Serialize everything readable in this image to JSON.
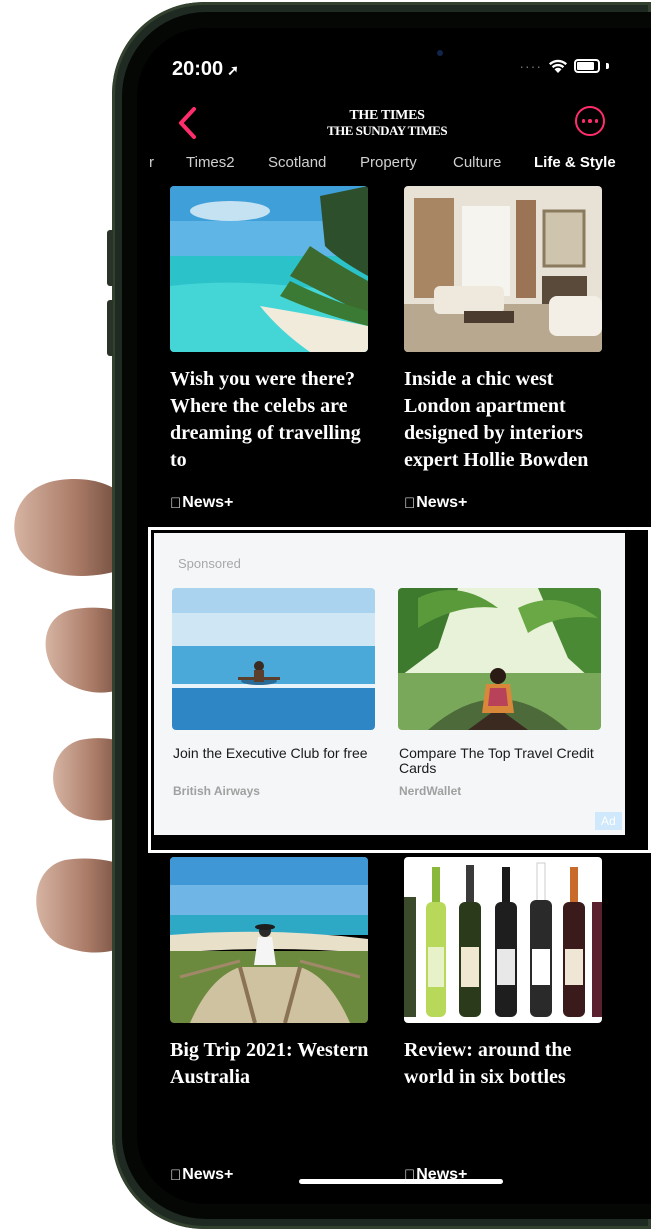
{
  "status_bar": {
    "time": "20:00"
  },
  "header": {
    "brand_line1": "THE TIMES",
    "brand_line2": "THE SUNDAY TIMES"
  },
  "tabs": [
    {
      "label": "r"
    },
    {
      "label": "Times2"
    },
    {
      "label": "Scotland"
    },
    {
      "label": "Property"
    },
    {
      "label": "Culture"
    },
    {
      "label": "Life & Style",
      "active": true
    }
  ],
  "articles": [
    {
      "headline": "Wish you were there? Where the celebs are dreaming of travelling to",
      "badge": "News+"
    },
    {
      "headline": "Inside a chic west London apartment designed by interiors expert Hollie Bowden",
      "badge": "News+"
    },
    {
      "headline": "Big Trip 2021: Western Australia",
      "badge": "News+"
    },
    {
      "headline": "Review: around the world in six bottles",
      "badge": "News+"
    }
  ],
  "sponsored": {
    "label": "Sponsored",
    "badge": "Ad",
    "items": [
      {
        "title": "Join the Executive Club for free",
        "advertiser": "British Airways"
      },
      {
        "title": "Compare The Top Travel Credit Cards",
        "advertiser": "NerdWallet"
      }
    ]
  },
  "colors": {
    "accent": "#ff2d6b",
    "background": "#000000",
    "ad_background": "#f4f6f7"
  }
}
